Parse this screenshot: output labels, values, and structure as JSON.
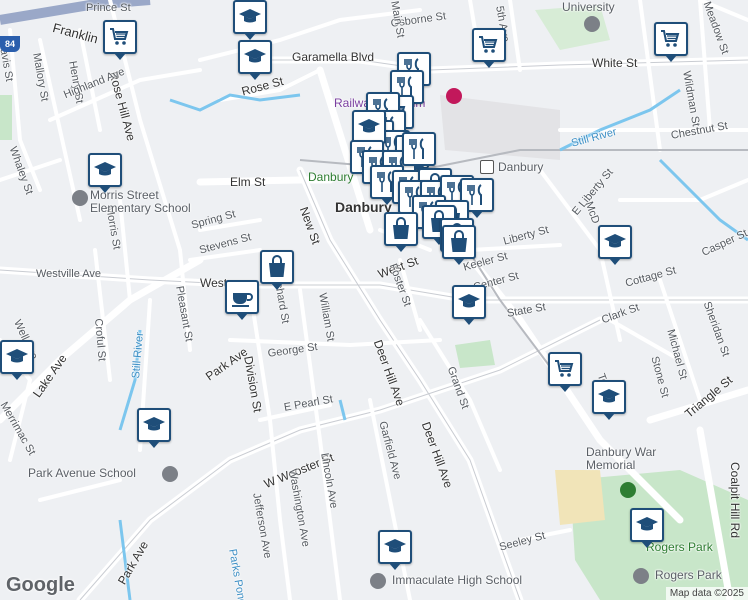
{
  "map": {
    "labels": {
      "prince_st": "Prince St",
      "osborne_st": "Osborne St",
      "franklin_st": "Franklin",
      "davis_st": "Davis St",
      "mallory_st": "Mallory St",
      "henry_st": "Henry St",
      "rose_hill_ave": "Rose Hill Ave",
      "highland_ave": "Highland Ave",
      "garamella_blvd": "Garamella Blvd",
      "rose_st": "Rose St",
      "white_st": "White St",
      "wildman_st": "Wildman St",
      "meadow_st": "Meadow St",
      "chestnut_st": "Chestnut St",
      "still_river_ne": "Still River",
      "danbury_station": "Danbury",
      "whaley_st": "Whaley St",
      "morris_st": "Morris St",
      "elm_st": "Elm St",
      "spring_st": "Spring St",
      "stevens_st": "Stevens St",
      "westville_ave": "Westville Ave",
      "new_st": "New St",
      "danbury_town": "Danbury",
      "danbury_town2": "Danbury",
      "west_st": "West St",
      "west_st2": "West",
      "liberty_st": "Liberty St",
      "e_liberty_st": "E Liberty St",
      "mcdonald": "McD",
      "casper_st": "Casper St",
      "keeler_st": "Keeler St",
      "center_st": "Center St",
      "cottage_st": "Cottage St",
      "state_st": "State St",
      "foster_st": "Foster St",
      "orchard_st": "Orchard St",
      "william_st": "William St",
      "pleasant_st": "Pleasant St",
      "croful_st": "Croful St",
      "well_ave": "Well Ave",
      "lake_ave": "Lake Ave",
      "still_river_w": "Still River",
      "park_ave": "Park Ave",
      "park_ave2": "Park Ave",
      "division_st": "Division St",
      "george_st": "George St",
      "deer_hill_ave": "Deer Hill Ave",
      "deer_hill_ave2": "Deer Hill Ave",
      "grand_st": "Grand St",
      "clark_st": "Clark St",
      "michael_st": "Michael St",
      "stone_st": "Stone St",
      "sheridan_st": "Sheridan St",
      "triangle_st": "Triangle St",
      "e_pearl_st": "E Pearl St",
      "garfield_ave": "Garfield Ave",
      "merrimac_st": "Merrimac St",
      "w_wooster_st": "W Wooster St",
      "lincoln_ave": "Lincoln Ave",
      "washington_ave": "Washington Ave",
      "jefferson_ave": "Jefferson Ave",
      "coalpit_hill_rd": "Coalpit Hill Rd",
      "seeley_st": "Seeley St",
      "parks_pond": "Parks Pond",
      "elm_street_school": "Morris Street\nElementary School",
      "park_avenue_school": "Park Avenue School",
      "immaculate_high_school": "Immaculate High School",
      "rogers_park": "Rogers Park",
      "rogers_park_middle": "Rogers Park",
      "danbury_war_memorial": "Danbury War\nMemorial",
      "railway_museum": "Railway Museum",
      "university": "University",
      "5th_ave": "5th Ave",
      "main_st": "Main St",
      "route_shield": "84",
      "t_st": "To"
    },
    "google": "Google",
    "attribution": "Map data ©2025"
  }
}
